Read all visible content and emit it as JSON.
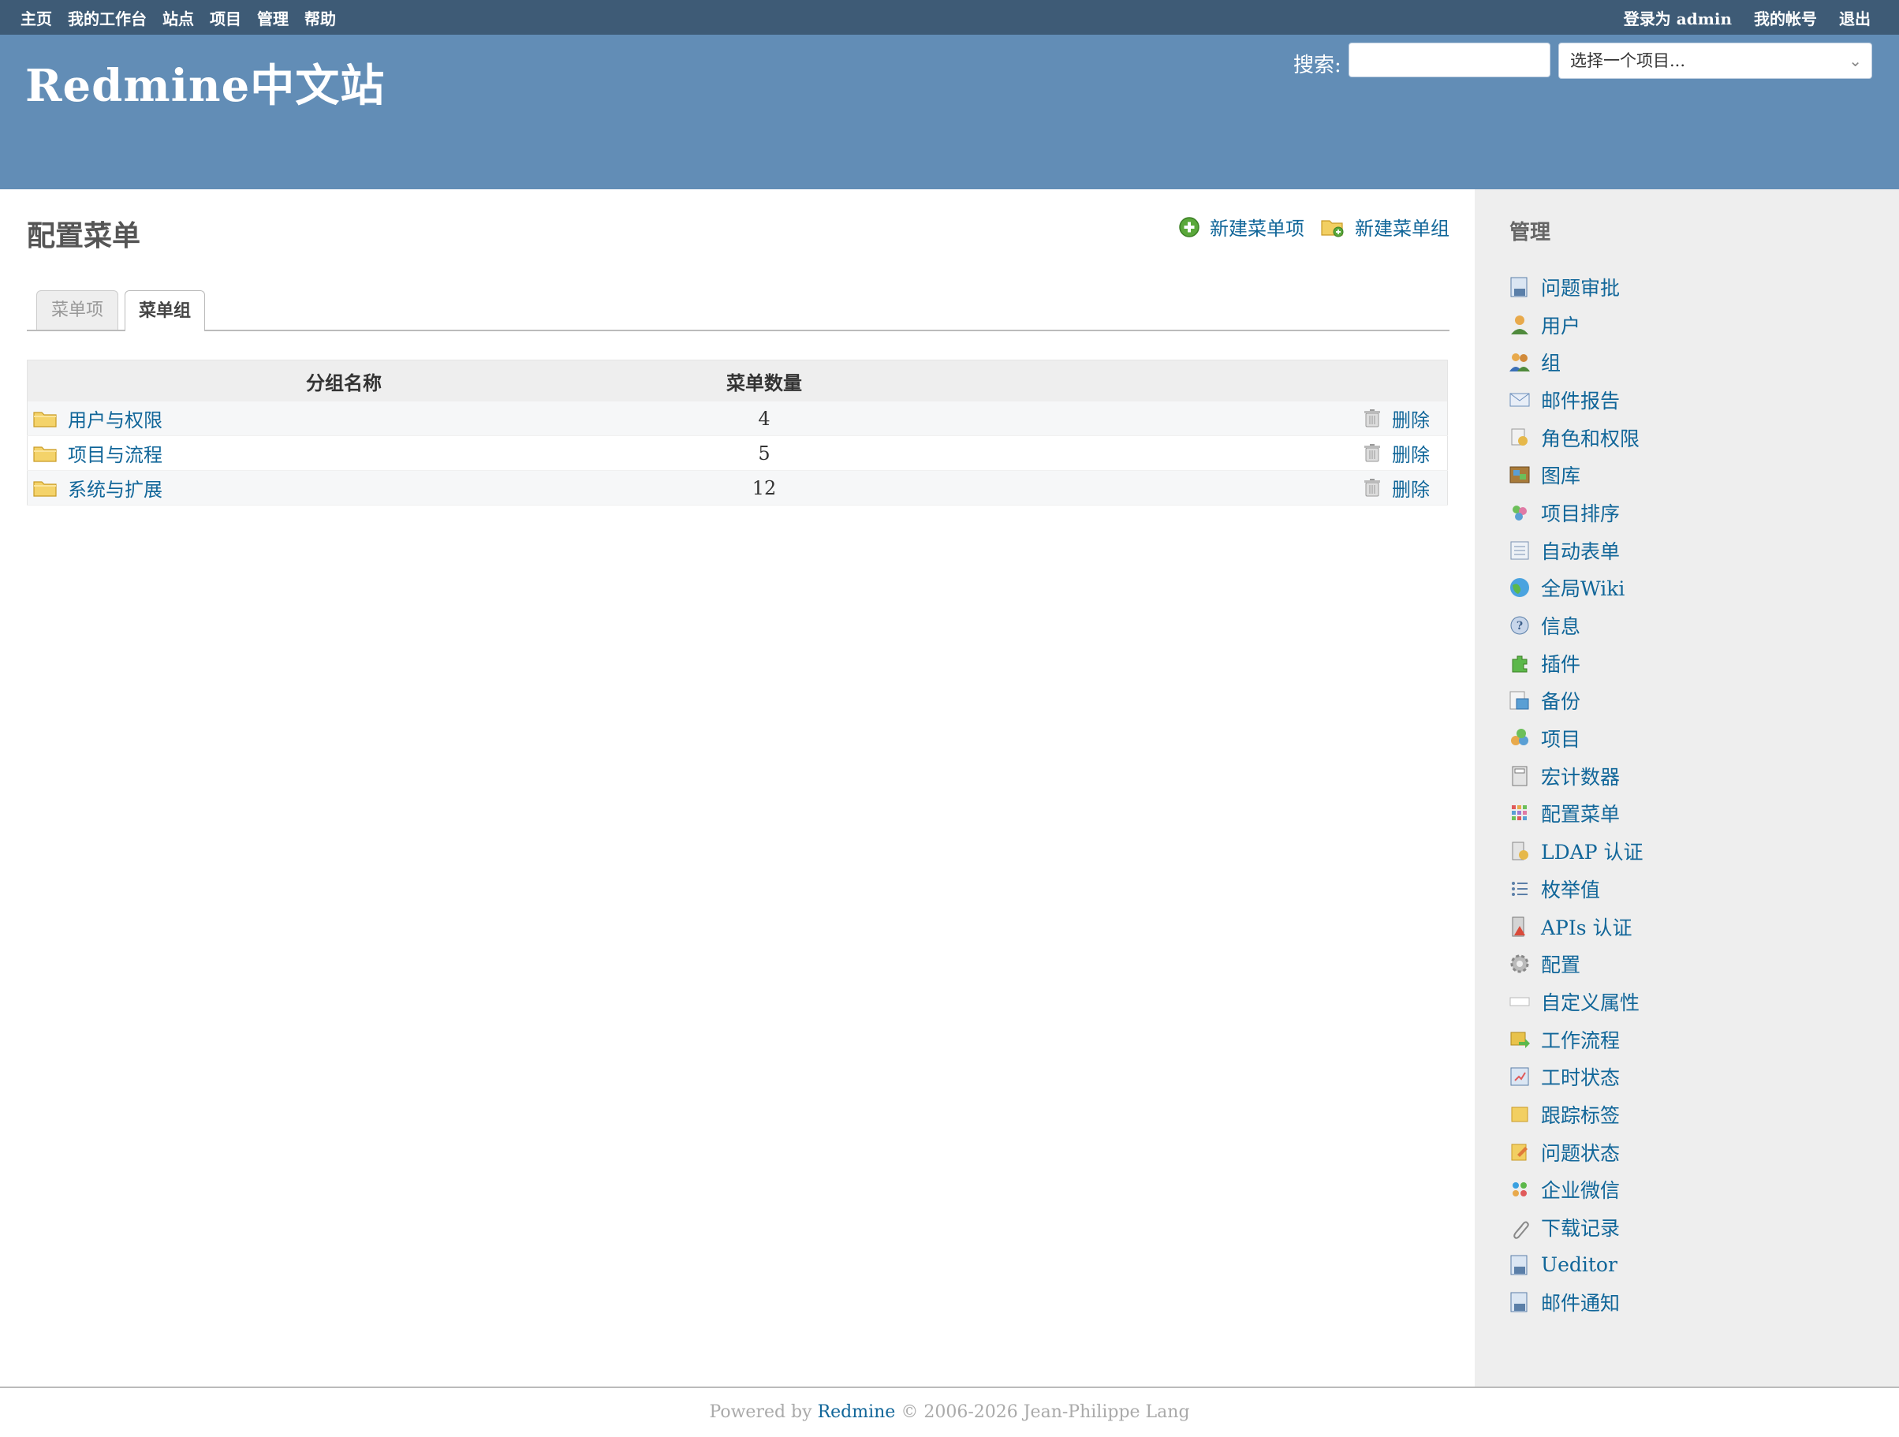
{
  "top_menu": {
    "items": [
      "主页",
      "我的工作台",
      "站点",
      "项目",
      "管理",
      "帮助"
    ],
    "login_prefix": "登录为",
    "login_user": "admin",
    "my_account": "我的帐号",
    "logout": "退出"
  },
  "header": {
    "site_title": "Redmine中文站",
    "search_label": "搜索:",
    "search_value": "",
    "project_select": "选择一个项目..."
  },
  "content": {
    "title": "配置菜单",
    "actions": {
      "new_menu_item": "新建菜单项",
      "new_menu_group": "新建菜单组"
    },
    "tabs": [
      {
        "label": "菜单项",
        "active": false
      },
      {
        "label": "菜单组",
        "active": true
      }
    ],
    "table": {
      "headers": [
        "分组名称",
        "菜单数量",
        ""
      ],
      "rows": [
        {
          "name": "用户与权限",
          "count": "4",
          "action": "删除"
        },
        {
          "name": "项目与流程",
          "count": "5",
          "action": "删除"
        },
        {
          "name": "系统与扩展",
          "count": "12",
          "action": "删除"
        }
      ]
    }
  },
  "sidebar": {
    "title": "管理",
    "items": [
      {
        "label": "问题审批",
        "icon": "approval-icon"
      },
      {
        "label": "用户",
        "icon": "user-icon"
      },
      {
        "label": "组",
        "icon": "group-icon"
      },
      {
        "label": "邮件报告",
        "icon": "mail-icon"
      },
      {
        "label": "角色和权限",
        "icon": "roles-icon"
      },
      {
        "label": "图库",
        "icon": "gallery-icon"
      },
      {
        "label": "项目排序",
        "icon": "project-sort-icon"
      },
      {
        "label": "自动表单",
        "icon": "auto-form-icon"
      },
      {
        "label": "全局Wiki",
        "icon": "globe-icon"
      },
      {
        "label": "信息",
        "icon": "info-icon"
      },
      {
        "label": "插件",
        "icon": "plugin-icon"
      },
      {
        "label": "备份",
        "icon": "backup-icon"
      },
      {
        "label": "项目",
        "icon": "projects-icon"
      },
      {
        "label": "宏计数器",
        "icon": "calculator-icon"
      },
      {
        "label": "配置菜单",
        "icon": "menu-config-icon"
      },
      {
        "label": "LDAP 认证",
        "icon": "ldap-icon"
      },
      {
        "label": "枚举值",
        "icon": "list-icon"
      },
      {
        "label": "APIs 认证",
        "icon": "api-icon"
      },
      {
        "label": "配置",
        "icon": "gear-icon"
      },
      {
        "label": "自定义属性",
        "icon": "custom-field-icon"
      },
      {
        "label": "工作流程",
        "icon": "workflow-icon"
      },
      {
        "label": "工时状态",
        "icon": "time-status-icon"
      },
      {
        "label": "跟踪标签",
        "icon": "tracker-icon"
      },
      {
        "label": "问题状态",
        "icon": "issue-status-icon"
      },
      {
        "label": "企业微信",
        "icon": "wechat-icon"
      },
      {
        "label": "下载记录",
        "icon": "attachment-icon"
      },
      {
        "label": "Ueditor",
        "icon": "editor-icon"
      },
      {
        "label": "邮件通知",
        "icon": "mail-notify-icon"
      }
    ]
  },
  "footer": {
    "powered_by": "Powered by",
    "link": "Redmine",
    "copyright": "© 2006-2026 Jean-Philippe Lang"
  }
}
